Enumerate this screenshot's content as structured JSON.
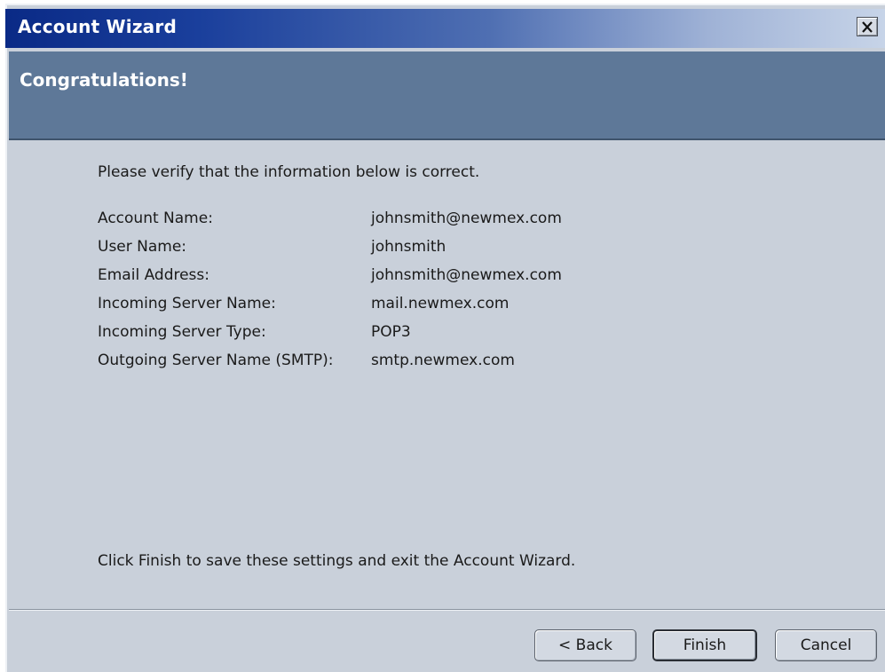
{
  "window": {
    "title": "Account Wizard",
    "close_icon": "close-x-icon"
  },
  "banner": {
    "title": "Congratulations!"
  },
  "content": {
    "intro": "Please verify that the information below is correct.",
    "rows": [
      {
        "label": "Account Name:",
        "value": "johnsmith@newmex.com"
      },
      {
        "label": "User Name:",
        "value": "johnsmith"
      },
      {
        "label": "Email Address:",
        "value": "johnsmith@newmex.com"
      },
      {
        "label": "Incoming Server Name:",
        "value": "mail.newmex.com"
      },
      {
        "label": "Incoming Server Type:",
        "value": "POP3"
      },
      {
        "label": "Outgoing Server Name (SMTP):",
        "value": "smtp.newmex.com"
      }
    ],
    "finish_note": "Click Finish to save these settings and exit the Account Wizard."
  },
  "buttons": {
    "back": "< Back",
    "finish": "Finish",
    "cancel": "Cancel"
  },
  "colors": {
    "titlebar_start": "#0a2a86",
    "banner": "#5e7898",
    "body": "#c9d0da"
  }
}
